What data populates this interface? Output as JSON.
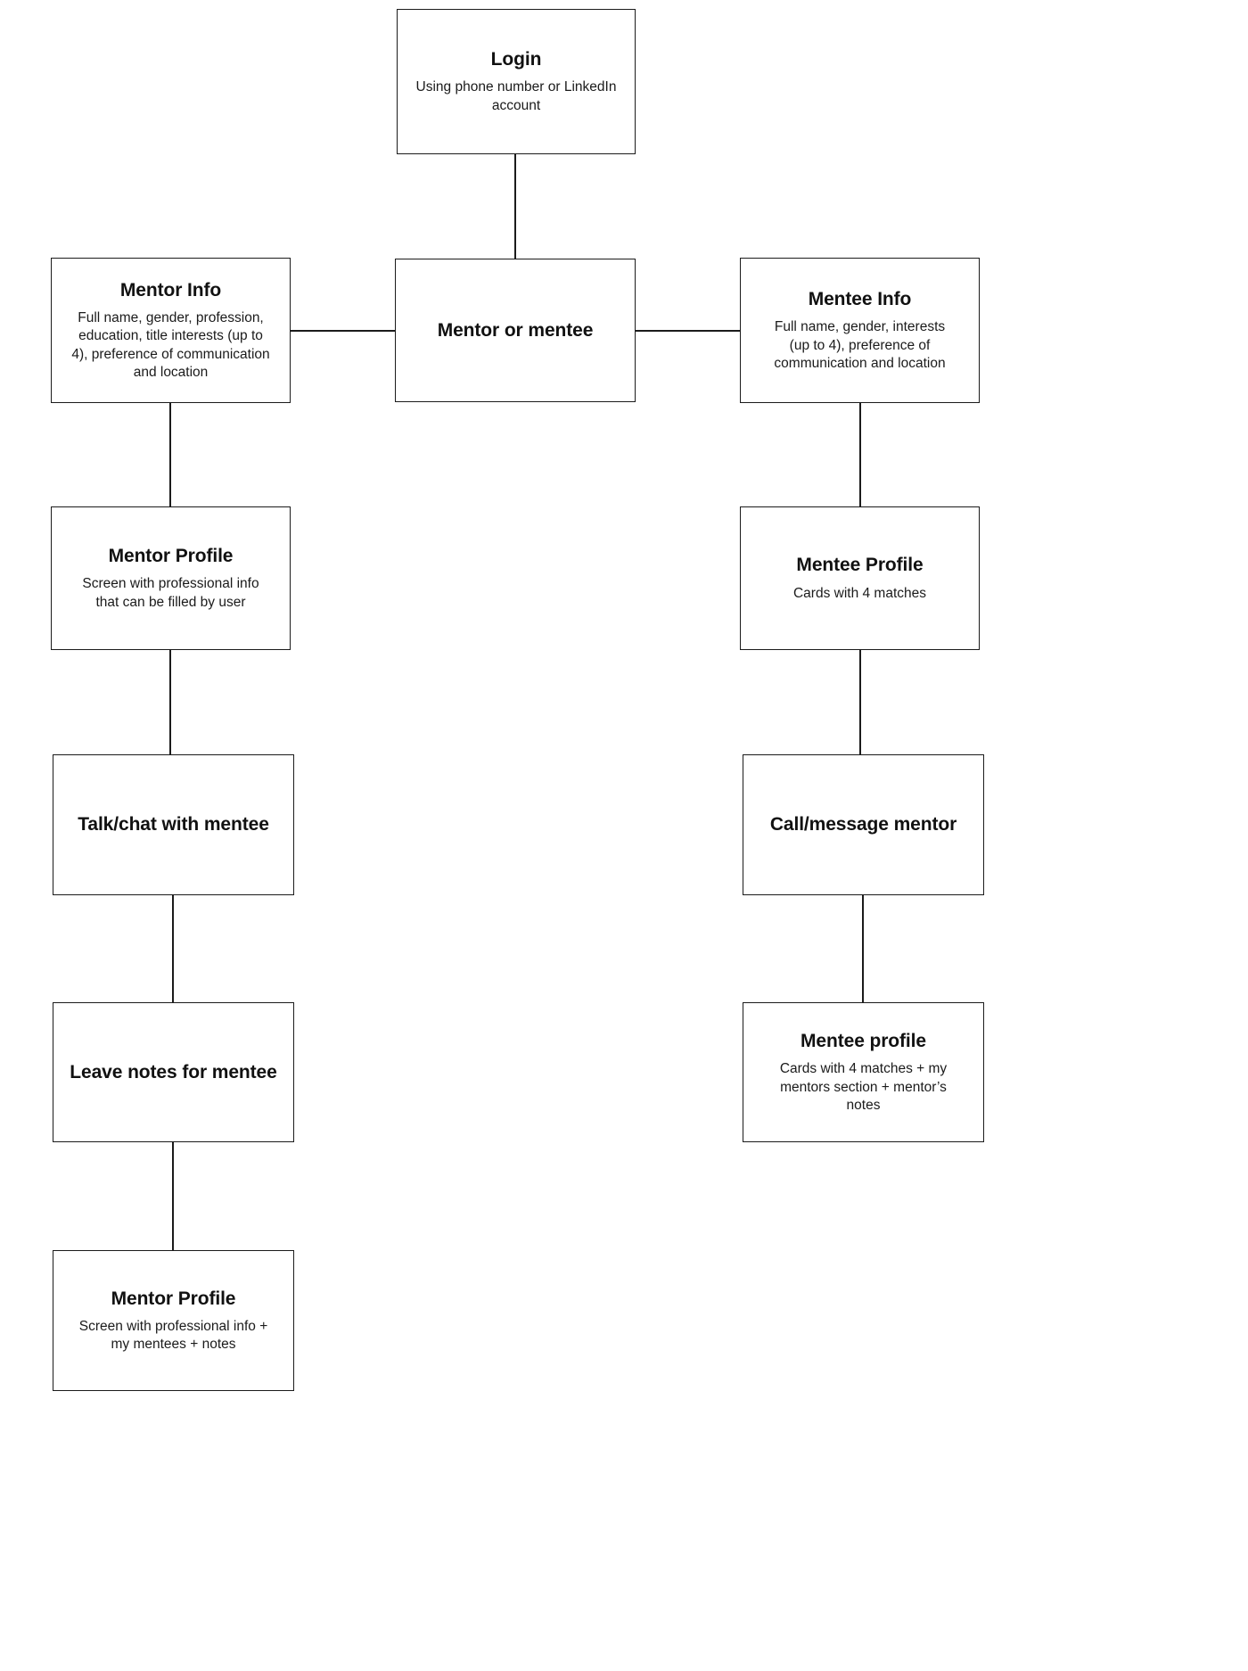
{
  "diagram": {
    "type": "flowchart",
    "orientation": "top-down",
    "background_color": "#ffffff",
    "box_border_color": "#1b1b1b",
    "text_color": "#111111",
    "nodes": [
      {
        "id": "login",
        "title": "Login",
        "desc": "Using phone number or LinkedIn account"
      },
      {
        "id": "mentor-or-mentee",
        "title": "Mentor or mentee",
        "desc": ""
      },
      {
        "id": "mentor-info",
        "title": "Mentor Info",
        "desc": "Full name, gender, profession, education, title interests (up to 4), preference of communication and location"
      },
      {
        "id": "mentee-info",
        "title": "Mentee Info",
        "desc": "Full name, gender, interests (up to 4), preference of communication and location"
      },
      {
        "id": "mentor-profile",
        "title": "Mentor Profile",
        "desc": "Screen with professional info that can be filled by user"
      },
      {
        "id": "mentee-profile",
        "title": "Mentee Profile",
        "desc": "Cards with 4 matches"
      },
      {
        "id": "talk-chat-with-mentee",
        "title": "Talk/chat with mentee",
        "desc": ""
      },
      {
        "id": "call-message-mentor",
        "title": "Call/message mentor",
        "desc": ""
      },
      {
        "id": "leave-notes-for-mentee",
        "title": "Leave notes for mentee",
        "desc": ""
      },
      {
        "id": "mentee-profile-expanded",
        "title": "Mentee profile",
        "desc": "Cards with 4 matches + my mentors section + mentor’s notes"
      },
      {
        "id": "mentor-profile-expanded",
        "title": "Mentor Profile",
        "desc": "Screen with professional info + my mentees + notes"
      }
    ],
    "edges": [
      {
        "from": "login",
        "to": "mentor-or-mentee",
        "kind": "vertical"
      },
      {
        "from": "mentor-info",
        "to": "mentor-or-mentee",
        "kind": "horizontal"
      },
      {
        "from": "mentor-or-mentee",
        "to": "mentee-info",
        "kind": "horizontal"
      },
      {
        "from": "mentor-info",
        "to": "mentor-profile",
        "kind": "vertical"
      },
      {
        "from": "mentee-info",
        "to": "mentee-profile",
        "kind": "vertical"
      },
      {
        "from": "mentor-profile",
        "to": "talk-chat-with-mentee",
        "kind": "vertical"
      },
      {
        "from": "mentee-profile",
        "to": "call-message-mentor",
        "kind": "vertical"
      },
      {
        "from": "talk-chat-with-mentee",
        "to": "leave-notes-for-mentee",
        "kind": "vertical"
      },
      {
        "from": "call-message-mentor",
        "to": "mentee-profile-expanded",
        "kind": "vertical"
      },
      {
        "from": "leave-notes-for-mentee",
        "to": "mentor-profile-expanded",
        "kind": "vertical"
      }
    ]
  }
}
